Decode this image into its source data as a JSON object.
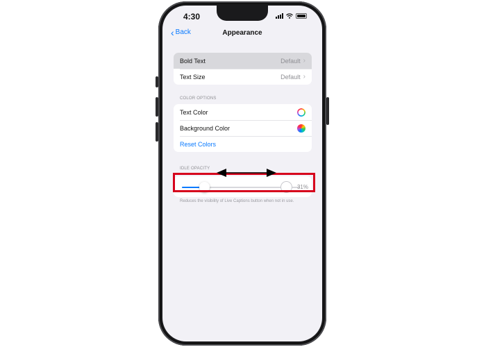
{
  "status_bar": {
    "time": "4:30"
  },
  "nav": {
    "back_label": "Back",
    "title": "Appearance"
  },
  "group1": {
    "rows": [
      {
        "label": "Bold Text",
        "value": "Default"
      },
      {
        "label": "Text Size",
        "value": "Default"
      }
    ]
  },
  "color_options": {
    "header": "COLOR OPTIONS",
    "rows": [
      {
        "label": "Text Color",
        "icon": "color-wheel-ring-icon"
      },
      {
        "label": "Background Color",
        "icon": "color-wheel-filled-icon"
      }
    ],
    "reset_label": "Reset Colors"
  },
  "idle_opacity": {
    "header": "IDLE OPACITY",
    "value_label": "31%",
    "value": 0.31,
    "footer": "Reduces the visibility of Live Captions button when not in use."
  },
  "colors": {
    "accent": "#0a7aff",
    "highlight": "#d6001c",
    "background": "#f2f1f6"
  },
  "annotation": {
    "type": "double-arrow-icon"
  }
}
